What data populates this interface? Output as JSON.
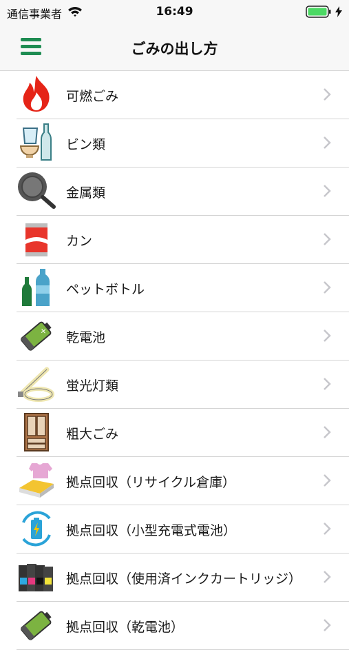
{
  "status_bar": {
    "carrier": "通信事業者",
    "time": "16:49",
    "icons": [
      "wifi-icon",
      "battery-icon",
      "charging-bolt-icon"
    ],
    "battery_color": "#4cd964"
  },
  "header": {
    "title": "ごみの出し方",
    "menu_icon": "hamburger-menu-icon",
    "accent_color": "#1e8c52"
  },
  "categories": [
    {
      "label": "可燃ごみ",
      "icon": "fire-icon"
    },
    {
      "label": "ビン類",
      "icon": "bottles-icon"
    },
    {
      "label": "金属類",
      "icon": "frying-pan-icon"
    },
    {
      "label": "カン",
      "icon": "can-icon"
    },
    {
      "label": "ペットボトル",
      "icon": "pet-bottle-icon"
    },
    {
      "label": "乾電池",
      "icon": "battery-cell-icon"
    },
    {
      "label": "蛍光灯類",
      "icon": "fluorescent-lamp-icon"
    },
    {
      "label": "粗大ごみ",
      "icon": "cabinet-icon"
    },
    {
      "label": "拠点回収（リサイクル倉庫）",
      "icon": "clothes-newspaper-icon"
    },
    {
      "label": "拠点回収（小型充電式電池）",
      "icon": "rechargeable-battery-icon"
    },
    {
      "label": "拠点回収（使用済インクカートリッジ）",
      "icon": "ink-cartridge-icon"
    },
    {
      "label": "拠点回収（乾電池）",
      "icon": "battery-cell-icon"
    }
  ]
}
